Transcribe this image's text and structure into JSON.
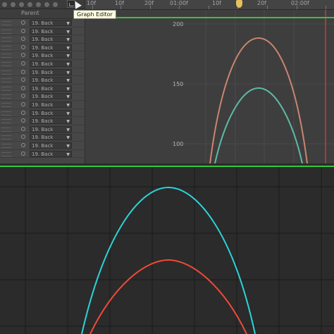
{
  "toolbar": {
    "graph_editor_tooltip": "Graph Editor"
  },
  "column_header": {
    "parent": "Parent"
  },
  "layers": [
    {
      "parent": "19. Back"
    },
    {
      "parent": "19. Back"
    },
    {
      "parent": "19. Back"
    },
    {
      "parent": "19. Back"
    },
    {
      "parent": "19. Back"
    },
    {
      "parent": "19. Back"
    },
    {
      "parent": "19. Back"
    },
    {
      "parent": "19. Back"
    },
    {
      "parent": "19. Back"
    },
    {
      "parent": "19. Back"
    },
    {
      "parent": "19. Back"
    },
    {
      "parent": "19. Back"
    },
    {
      "parent": "19. Back"
    },
    {
      "parent": "19. Back"
    },
    {
      "parent": "19. Back"
    },
    {
      "parent": "19. Back"
    },
    {
      "parent": "19. Back"
    }
  ],
  "ruler": {
    "labels": [
      "10f",
      "10f",
      "20f",
      "01:00f",
      "10f",
      "20f",
      "02:00f"
    ]
  },
  "top_graph": {
    "y_labels": [
      "200",
      "150",
      "100"
    ],
    "colors": {
      "curve_a": "#c98570",
      "curve_b": "#5fb9a6",
      "cti": "#c83a3a",
      "grid": "#4a4a4a"
    }
  },
  "bottom_graph": {
    "colors": {
      "curve_a": "#2ad4d8",
      "curve_b": "#ef4a36",
      "grid": "#1b1b1b"
    }
  }
}
